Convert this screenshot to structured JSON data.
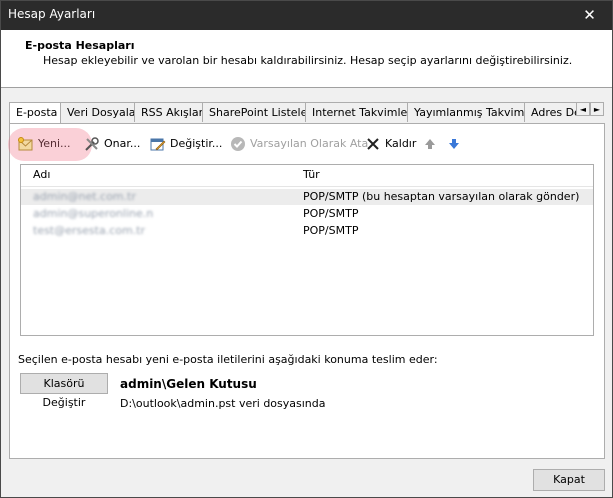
{
  "window": {
    "title": "Hesap Ayarları",
    "close_glyph": "✕"
  },
  "header": {
    "title": "E-posta Hesapları",
    "description": "Hesap ekleyebilir ve varolan bir hesabı kaldırabilirsiniz. Hesap seçip ayarlarını değiştirebilirsiniz."
  },
  "tabs": [
    {
      "label": "E-posta",
      "active": true
    },
    {
      "label": "Veri Dosyaları"
    },
    {
      "label": "RSS Akışları"
    },
    {
      "label": "SharePoint Listeleri"
    },
    {
      "label": "Internet Takvimleri"
    },
    {
      "label": "Yayımlanmış Takvimler"
    },
    {
      "label": "Adres Defterleri"
    }
  ],
  "tab_scroll": {
    "left": "◄",
    "right": "►"
  },
  "toolbar": {
    "new_label": "Yeni...",
    "repair_label": "Onar...",
    "change_label": "Değiştir...",
    "set_default_label": "Varsayılan Olarak Ata",
    "remove_label": "Kaldır"
  },
  "list": {
    "headers": {
      "name": "Adı",
      "type": "Tür"
    },
    "rows": [
      {
        "name": "admin@net.com.tr",
        "type": "POP/SMTP (bu hesaptan varsayılan olarak gönder)",
        "selected": true
      },
      {
        "name": "admin@superonline.n",
        "type": "POP/SMTP"
      },
      {
        "name": "test@ersesta.com.tr",
        "type": "POP/SMTP"
      }
    ]
  },
  "delivery": {
    "label": "Seçilen e-posta hesabı yeni e-posta iletilerini aşağıdaki konuma teslim eder:",
    "change_folder_label": "Klasörü Değiştir",
    "folder_name": "admin\\Gelen Kutusu",
    "folder_path": "D:\\outlook\\admin.pst veri dosyasında"
  },
  "footer": {
    "close_label": "Kapat"
  },
  "colors": {
    "titlebar": "#2b2b2b",
    "highlight": "#f0788c",
    "arrow_up": "#9a9a9a",
    "arrow_down": "#3a78d8"
  }
}
